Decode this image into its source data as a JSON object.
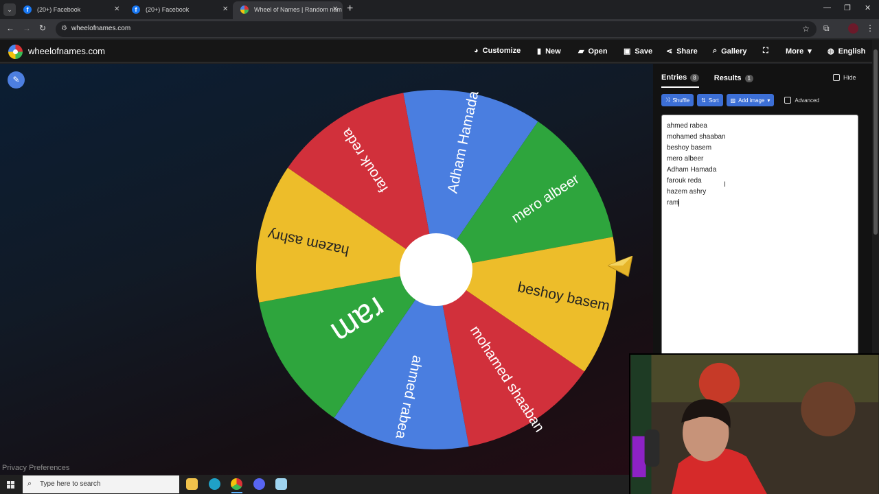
{
  "browser": {
    "tabs": [
      {
        "title": "(20+) Facebook"
      },
      {
        "title": "(20+) Facebook"
      },
      {
        "title": "Wheel of Names | Random nam"
      }
    ],
    "url": "wheelofnames.com"
  },
  "site": {
    "logo_text": "wheelofnames.com",
    "nav": {
      "customize": "Customize",
      "new": "New",
      "open": "Open",
      "save": "Save",
      "share": "Share",
      "gallery": "Gallery",
      "more": "More",
      "language": "English"
    }
  },
  "wheel": {
    "colors": {
      "red": "#d1303b",
      "blue": "#4a7ee0",
      "green": "#2ea53d",
      "yellow": "#edbd2a"
    },
    "segments": [
      {
        "label": "Adham Hamada",
        "color": "blue"
      },
      {
        "label": "mero albeer",
        "color": "green"
      },
      {
        "label": "beshoy basem",
        "color": "yellow"
      },
      {
        "label": "mohamed shaaban",
        "color": "red"
      },
      {
        "label": "ahmed rabea",
        "color": "blue"
      },
      {
        "label": "ram",
        "color": "green"
      },
      {
        "label": "hazem ashry",
        "color": "yellow"
      },
      {
        "label": "farouk reda",
        "color": "red"
      }
    ]
  },
  "panel": {
    "entries_tab": "Entries",
    "entries_count": "8",
    "results_tab": "Results",
    "results_count": "1",
    "hide_label": "Hide",
    "shuffle": "Shuffle",
    "sort": "Sort",
    "add_image": "Add image",
    "advanced": "Advanced",
    "entries": [
      "ahmed rabea",
      "mohamed shaaban",
      "beshoy basem",
      "mero albeer",
      "Adham Hamada",
      "farouk reda",
      "hazem ashry",
      "ram"
    ]
  },
  "footer": {
    "privacy": "Privacy Preferences"
  },
  "taskbar": {
    "search_placeholder": "Type here to search"
  }
}
